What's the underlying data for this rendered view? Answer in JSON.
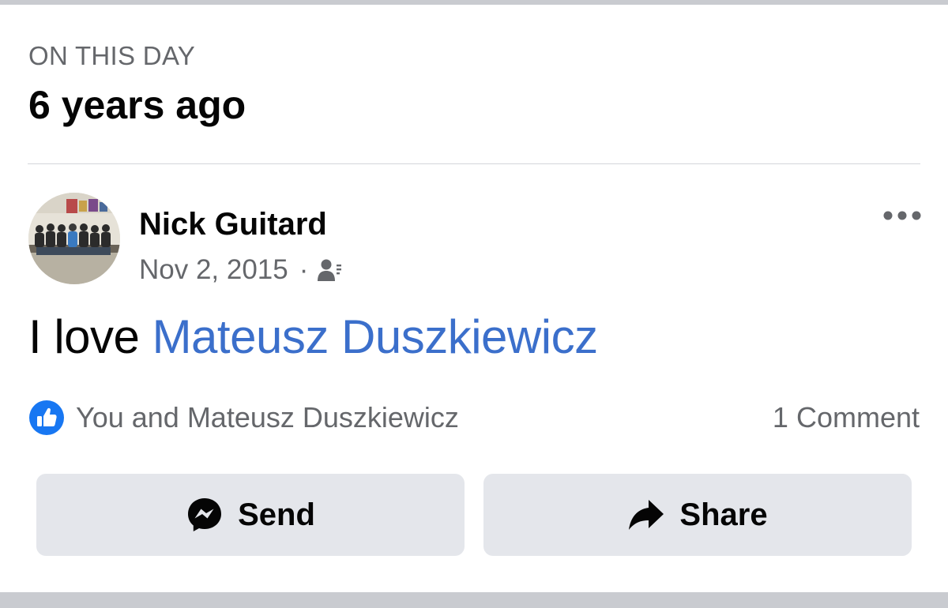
{
  "memory": {
    "eyebrow": "ON THIS DAY",
    "headline": "6 years ago"
  },
  "post": {
    "author": "Nick Guitard",
    "date": "Nov 2, 2015",
    "separator": "·",
    "audience_icon": "friends-audience-icon",
    "body_prefix": "I love ",
    "mention": "Mateusz Duszkiewicz",
    "mention_color": "#3b6fcb"
  },
  "engagement": {
    "reaction_icon": "like-reaction-icon",
    "reactions_text": "You and Mateusz Duszkiewicz",
    "comments_text": "1 Comment",
    "like_color": "#1877f2"
  },
  "actions": {
    "send_label": "Send",
    "send_icon": "messenger-icon",
    "share_label": "Share",
    "share_icon": "share-arrow-icon"
  },
  "menu": {
    "more_icon": "more-options-icon"
  }
}
